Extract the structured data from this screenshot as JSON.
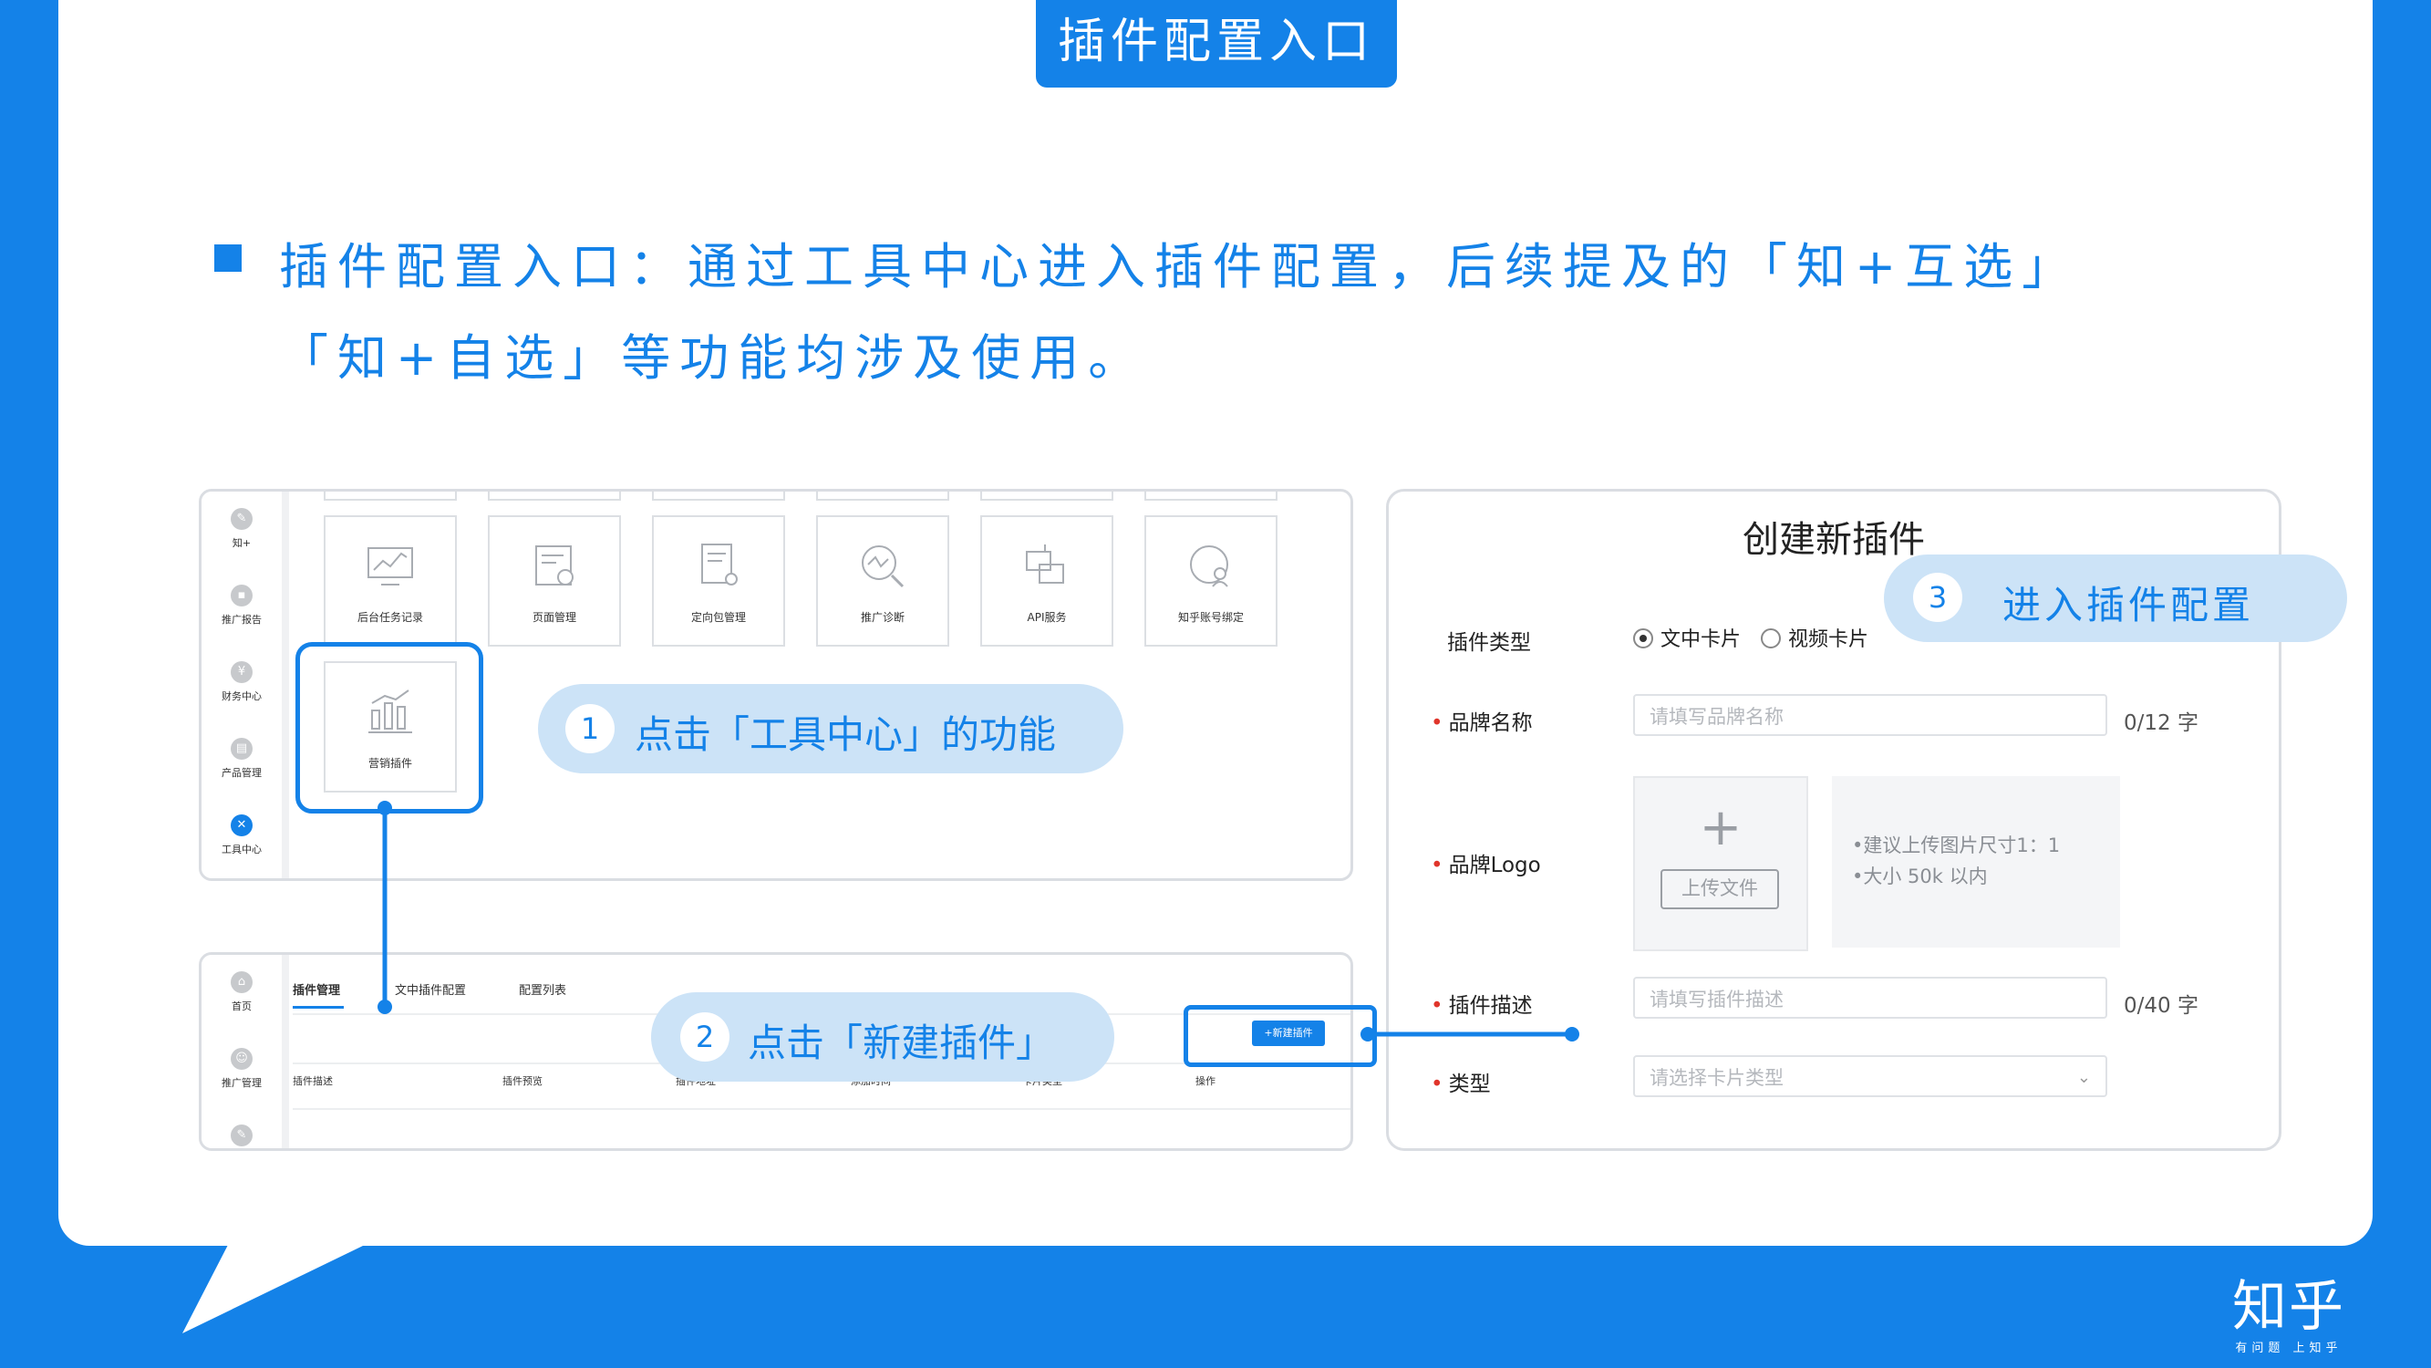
{
  "header": {
    "title": "插件配置入口"
  },
  "intro": {
    "line1": "插件配置入口：通过工具中心进入插件配置，后续提及的「知+互选」",
    "line2": "「知+自选」等功能均涉及使用。"
  },
  "left_top": {
    "sidebar": [
      {
        "icon": "zhiplus-icon",
        "label": "知+"
      },
      {
        "icon": "report-icon",
        "label": "推广报告"
      },
      {
        "icon": "finance-icon",
        "label": "财务中心"
      },
      {
        "icon": "product-icon",
        "label": "产品管理"
      },
      {
        "icon": "tools-icon",
        "label": "工具中心",
        "active": true
      }
    ],
    "tiles": [
      {
        "icon": "task-record-icon",
        "label": "后台任务记录"
      },
      {
        "icon": "page-manage-icon",
        "label": "页面管理"
      },
      {
        "icon": "package-icon",
        "label": "定向包管理"
      },
      {
        "icon": "diagnose-icon",
        "label": "推广诊断"
      },
      {
        "icon": "api-icon",
        "label": "API服务"
      },
      {
        "icon": "account-bind-icon",
        "label": "知乎账号绑定"
      }
    ],
    "plugin_tile": {
      "icon": "marketing-plugin-icon",
      "label": "营销插件"
    }
  },
  "steps": [
    {
      "num": "1",
      "text": "点击「工具中心」的功能"
    },
    {
      "num": "2",
      "text": "点击「新建插件」"
    },
    {
      "num": "3",
      "text": "进入插件配置"
    }
  ],
  "left_bottom": {
    "sidebar": [
      {
        "icon": "home-icon",
        "label": "首页"
      },
      {
        "icon": "promo-manage-icon",
        "label": "推广管理"
      }
    ],
    "tabs": [
      "插件管理",
      "文中插件配置",
      "配置列表"
    ],
    "new_button": "+新建插件",
    "columns": [
      "插件描述",
      "插件预览",
      "插件地址",
      "添加时间",
      "卡片类型",
      "操作"
    ]
  },
  "form": {
    "title": "创建新插件",
    "type_label": "插件类型",
    "type_options": [
      "文中卡片",
      "视频卡片"
    ],
    "type_selected": "文中卡片",
    "brand_label": "品牌名称",
    "brand_placeholder": "请填写品牌名称",
    "brand_count": "0/12 字",
    "logo_label": "品牌Logo",
    "upload_button": "上传文件",
    "logo_tips": [
      "•建议上传图片尺寸1：1",
      "•大小 50k 以内"
    ],
    "desc_label": "插件描述",
    "desc_placeholder": "请填写插件描述",
    "desc_count": "0/40 字",
    "kind_label": "类型",
    "kind_placeholder": "请选择卡片类型"
  },
  "footer": {
    "logo": "知乎",
    "slogan": "有问题 上知乎"
  },
  "colors": {
    "brand": "#1482e8",
    "bubble": "#cce3f7"
  }
}
